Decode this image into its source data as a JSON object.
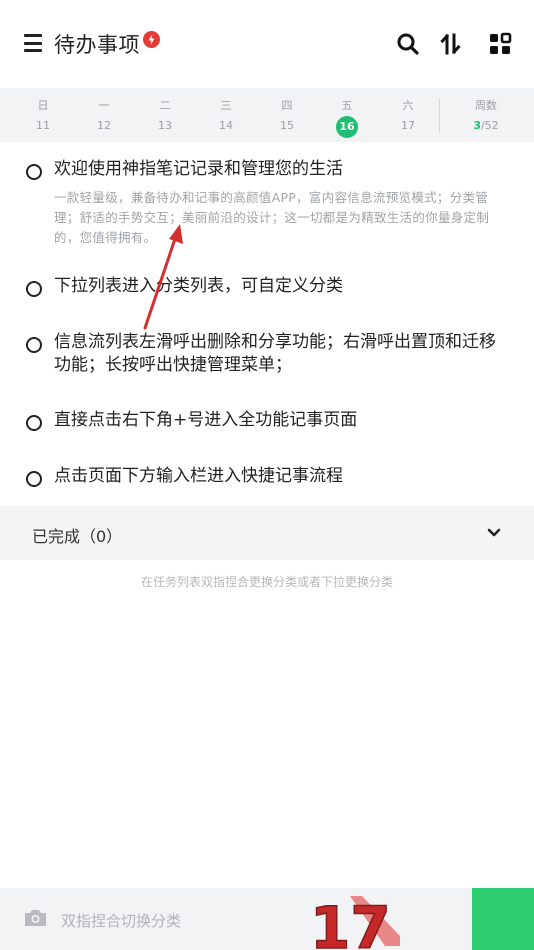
{
  "header": {
    "title": "待办事项",
    "icons": [
      "menu-icon",
      "flash-badge-icon",
      "search-icon",
      "sort-icon",
      "grid-icon"
    ]
  },
  "week": {
    "days": [
      {
        "name": "日",
        "num": "11"
      },
      {
        "name": "一",
        "num": "12"
      },
      {
        "name": "二",
        "num": "13"
      },
      {
        "name": "三",
        "num": "14"
      },
      {
        "name": "四",
        "num": "15"
      },
      {
        "name": "五",
        "num": "16"
      },
      {
        "name": "六",
        "num": "17"
      }
    ],
    "selected_day": "16",
    "weeknum_label": "周数",
    "weeknum_current": "3",
    "weeknum_total": "/52"
  },
  "tasks": [
    {
      "title": "欢迎使用神指笔记记录和管理您的生活",
      "desc": "一款轻量级，兼备待办和记事的高颜值APP，富内容信息流预览模式；分类管理；舒适的手势交互；美丽前沿的设计；这一切都是为精致生活的你量身定制的，您值得拥有。"
    },
    {
      "title": "下拉列表进入分类列表，可自定义分类"
    },
    {
      "title": "信息流列表左滑呼出删除和分享功能；右滑呼出置顶和迁移功能；长按呼出快捷管理菜单；"
    },
    {
      "title": "直接点击右下角+号进入全功能记事页面"
    },
    {
      "title": "点击页面下方输入栏进入快捷记事流程"
    }
  ],
  "completed": {
    "label": "已完成（0）"
  },
  "hint": "在任务列表双指捏合更换分类或者下拉更换分类",
  "bottom": {
    "placeholder": "双指捏合切换分类",
    "badge_number": "17"
  },
  "colors": {
    "accent": "#1dbf73",
    "badge": "#e53935",
    "arrow": "#d32f2f"
  }
}
